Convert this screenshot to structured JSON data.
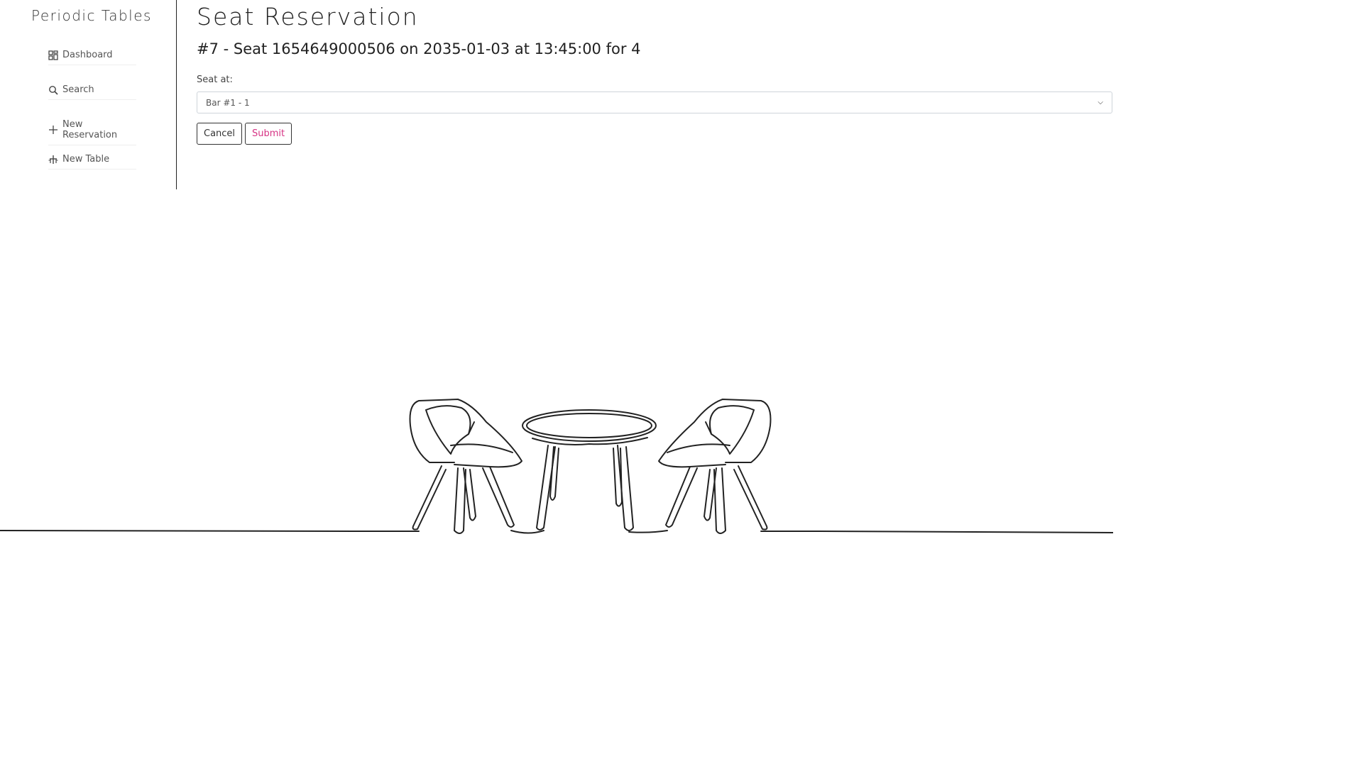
{
  "sidebar": {
    "brand": "Periodic Tables",
    "items": [
      {
        "label": "Dashboard",
        "icon": "dashboard-icon"
      },
      {
        "label": "Search",
        "icon": "search-icon"
      },
      {
        "label": "New Reservation",
        "icon": "plus-icon"
      },
      {
        "label": "New Table",
        "icon": "table-icon"
      }
    ]
  },
  "main": {
    "title": "Seat Reservation",
    "reservation_heading": "#7 - Seat 1654649000506 on 2035-01-03 at 13:45:00 for 4",
    "seat_label": "Seat at:",
    "seat_select": {
      "selected": "Bar #1 - 1"
    },
    "buttons": {
      "cancel": "Cancel",
      "submit": "Submit"
    }
  },
  "colors": {
    "accent": "#d63384",
    "text": "#212529",
    "border": "#ced4da"
  },
  "illustration": {
    "icon": "table-and-chairs-illustration"
  }
}
